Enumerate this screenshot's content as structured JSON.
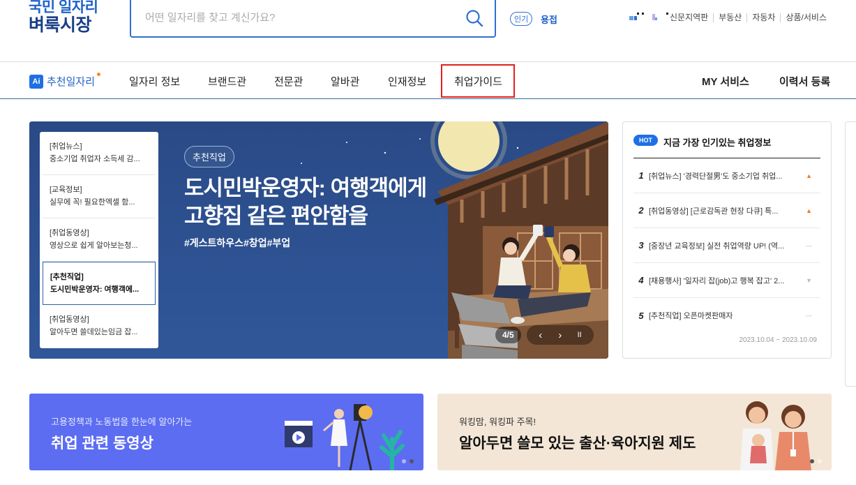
{
  "logo": {
    "line1": "국민 일자리",
    "line2": "벼룩시장"
  },
  "search": {
    "placeholder": "어떤 일자리를 찾고 계신가요?"
  },
  "popular": {
    "badge": "인기",
    "keyword": "용접"
  },
  "top_links": [
    "신문지역판",
    "부동산",
    "자동차",
    "상품/서비스"
  ],
  "nav": {
    "ai_box": "Ai",
    "ai_label": "추천일자리",
    "items": [
      "일자리 정보",
      "브랜드관",
      "전문관",
      "알바관",
      "인재정보",
      "취업가이드"
    ],
    "right": [
      "MY 서비스",
      "이력서 등록"
    ]
  },
  "banner": {
    "side_items": [
      {
        "cat": "[취업뉴스]",
        "title": "중소기업 취업자 소득세 감..."
      },
      {
        "cat": "[교육정보]",
        "title": "실무에 꼭! 필요한엑셀 함..."
      },
      {
        "cat": "[취업동영상]",
        "title": "영상으로 쉽게 알아보는청..."
      },
      {
        "cat": "[추천직업]",
        "title": "도시민박운영자: 여행객에..."
      },
      {
        "cat": "[취업동영상]",
        "title": "알아두면 쓸데있는임금 잡..."
      }
    ],
    "tag": "추천직업",
    "title_line1": "도시민박운영자: 여행객에게",
    "title_line2": "고향집 같은 편안함을",
    "hashtags": "#게스트하우스#창업#부업",
    "page_counter": "4/5",
    "prev": "‹",
    "next": "›",
    "pause": "II"
  },
  "hot_box": {
    "badge": "HOT",
    "title": "지금 가장 인기있는 취업정보",
    "items": [
      {
        "num": "1",
        "text": "[취업뉴스] '경력단절男'도 중소기업 취업...",
        "trend": "up",
        "trend_glyph": "▲"
      },
      {
        "num": "2",
        "text": "[취업동영상] [근로감독관 현장 다큐] 특...",
        "trend": "up",
        "trend_glyph": "▲"
      },
      {
        "num": "3",
        "text": "[중장년 교육정보] 실전 취업역량 UP! (역...",
        "trend": "same",
        "trend_glyph": "—"
      },
      {
        "num": "4",
        "text": "[채용행사] '일자리 잡(job)고 행복 잡고' 2...",
        "trend": "down",
        "trend_glyph": "▼"
      },
      {
        "num": "5",
        "text": "[추천직업] 오픈마켓판매자",
        "trend": "same",
        "trend_glyph": "—"
      }
    ],
    "date_range": "2023.10.04 ~ 2023.10.09"
  },
  "bottom_banners": [
    {
      "sub": "고용정책과 노동법을 한눈에 알아가는",
      "main": "취업 관련 동영상"
    },
    {
      "sub": "워킹맘, 워킹파 주목!",
      "main": "알아두면 쓸모 있는 출산·육아지원 제도"
    }
  ],
  "colors": {
    "brand_blue": "#1f61c9",
    "banner_bg": "#2b4f8a",
    "highlight_red": "#e01e1e",
    "bb1_bg": "#5c6df2",
    "bb2_bg": "#f3e6d6"
  }
}
